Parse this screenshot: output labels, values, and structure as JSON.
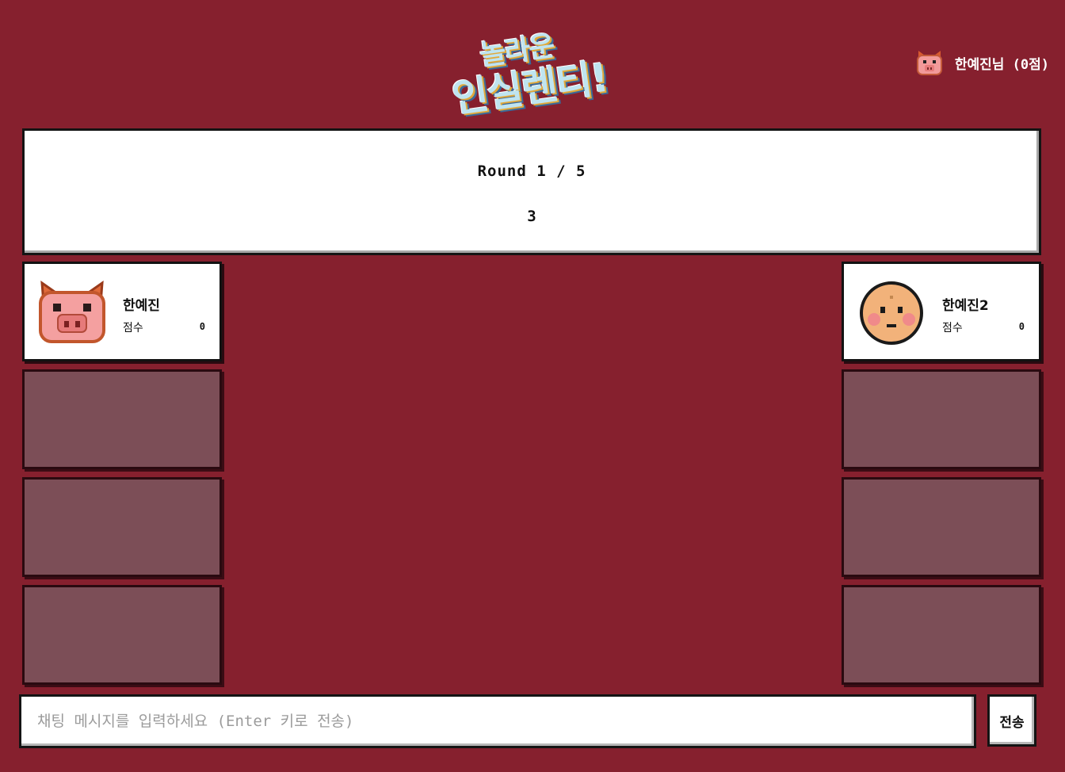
{
  "logo": {
    "line1": "놀라운",
    "line2": "인실렌티!"
  },
  "user": {
    "label": "한예진님 (0점)",
    "avatar_icon": "pig-icon"
  },
  "round": {
    "title": "Round 1 / 5",
    "countdown": "3"
  },
  "players": {
    "left": [
      {
        "name": "한예진",
        "score_label": "점수",
        "score": "0",
        "avatar_icon": "pig-icon"
      }
    ],
    "right": [
      {
        "name": "한예진2",
        "score_label": "점수",
        "score": "0",
        "avatar_icon": "face-icon"
      }
    ]
  },
  "chat": {
    "placeholder": "채팅 메시지를 입력하세요 (Enter 키로 전송)",
    "send_label": "전송"
  },
  "colors": {
    "background": "#86202e",
    "empty_slot": "#7c4e57",
    "panel": "#ffffff"
  }
}
